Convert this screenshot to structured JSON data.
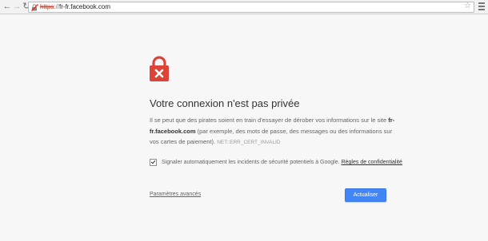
{
  "browser": {
    "back_icon": "back-arrow-icon",
    "forward_icon": "forward-arrow-icon",
    "reload_icon": "reload-icon",
    "url_scheme": "https",
    "url_separator": "://",
    "url_host": "fr-fr.facebook.com",
    "bookmark_icon": "star-icon",
    "menu_icon": "hamburger-menu-icon"
  },
  "interstitial": {
    "icon": "broken-lock-icon",
    "title": "Votre connexion n'est pas privée",
    "message_part1": "Il se peut que des pirates soient en train d'essayer de dérober vos informations sur le site ",
    "message_host": "fr-fr.facebook.com",
    "message_part2": " (par exemple, des mots de passe, des messages ou des informations sur vos cartes de paiement).",
    "error_code": "NET::ERR_CERT_INVALID",
    "report_checkbox_label": "Signaler automatiquement les incidents de sécurité potentiels à Google.",
    "report_checked": true,
    "privacy_link": "Règles de confidentialité",
    "advanced_link": "Paramètres avancés",
    "reload_button": "Actualiser"
  },
  "colors": {
    "danger_red": "#db4437",
    "button_blue": "#4285f4",
    "background": "#f7f7f7"
  }
}
